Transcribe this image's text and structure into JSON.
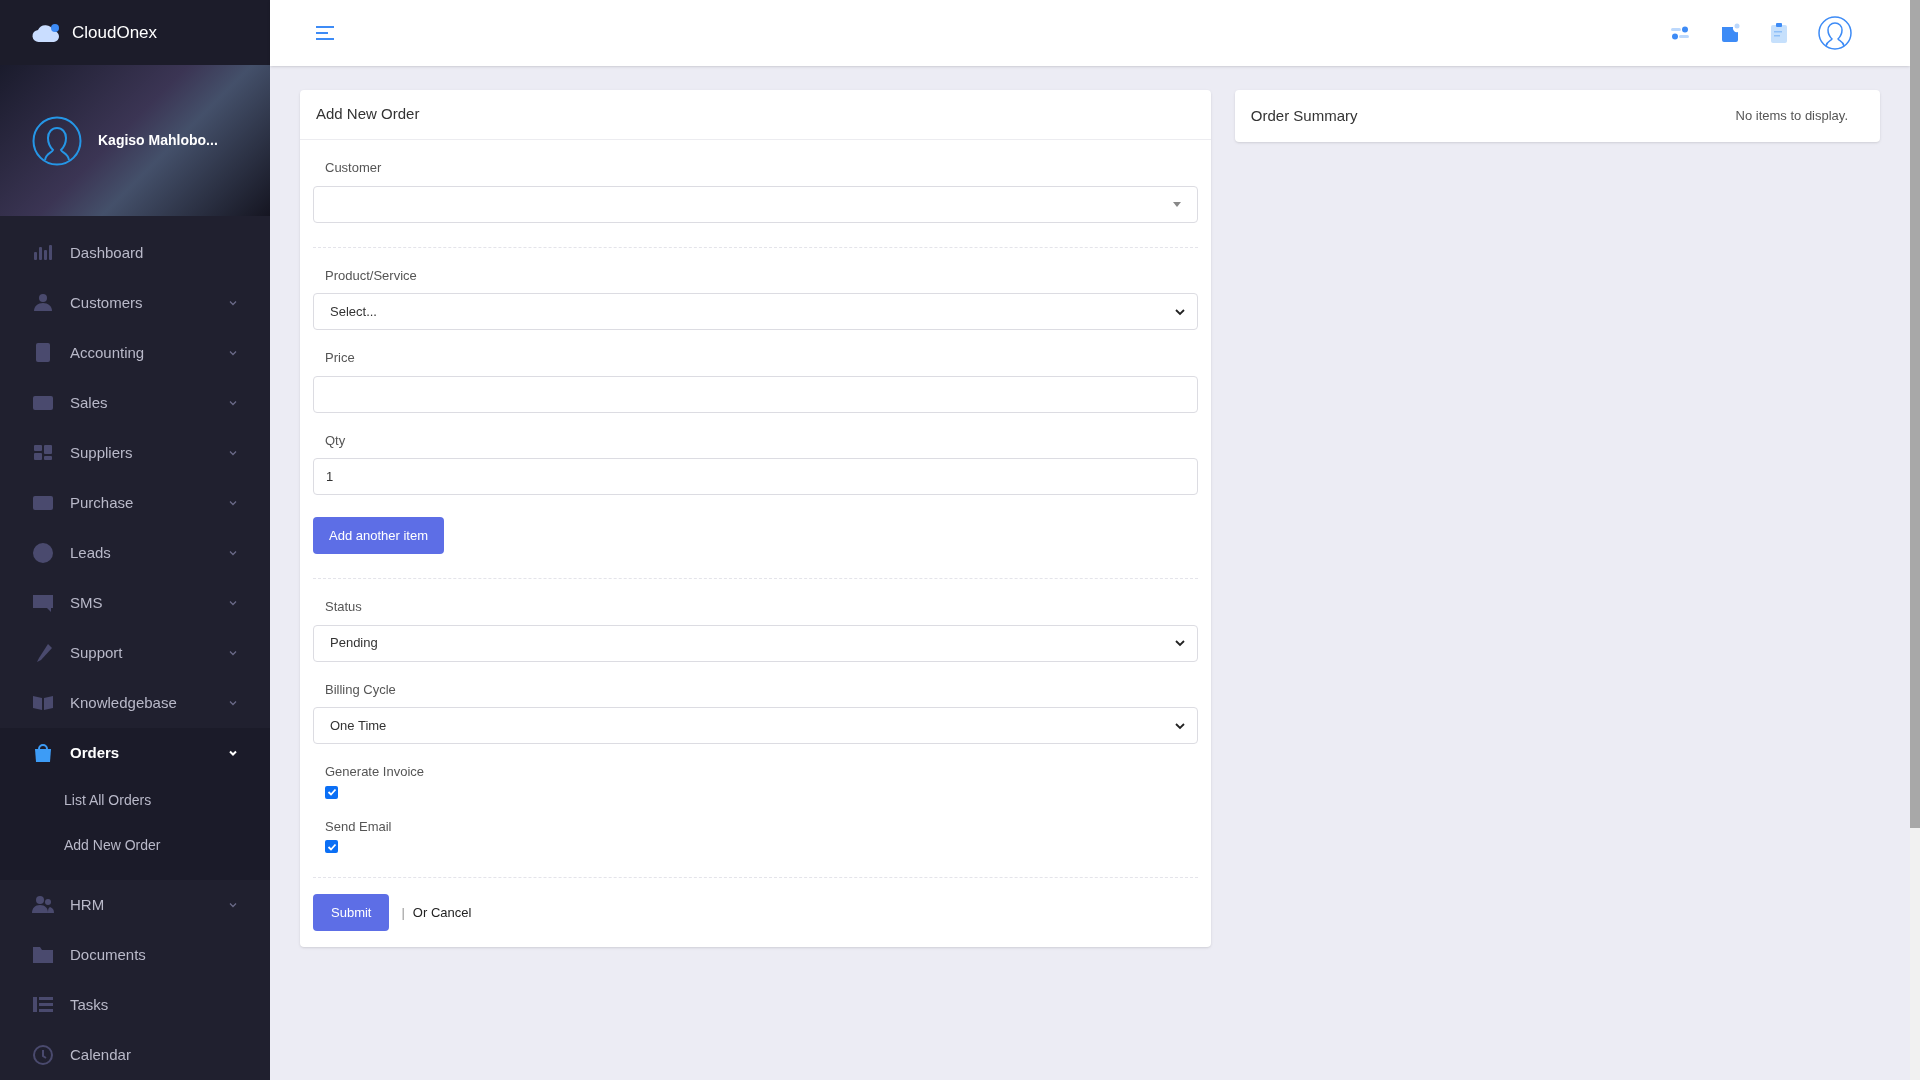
{
  "brand": {
    "name": "CloudOnex"
  },
  "profile": {
    "name": "Kagiso Mahlobo..."
  },
  "sidebar": {
    "items": [
      {
        "label": "Dashboard",
        "kind": "link",
        "selected": false
      },
      {
        "label": "Customers",
        "kind": "group",
        "selected": false,
        "expanded": false
      },
      {
        "label": "Accounting",
        "kind": "group",
        "selected": false,
        "expanded": false
      },
      {
        "label": "Sales",
        "kind": "group",
        "selected": false,
        "expanded": false
      },
      {
        "label": "Suppliers",
        "kind": "group",
        "selected": false,
        "expanded": false
      },
      {
        "label": "Purchase",
        "kind": "group",
        "selected": false,
        "expanded": false
      },
      {
        "label": "Leads",
        "kind": "group",
        "selected": false,
        "expanded": false
      },
      {
        "label": "SMS",
        "kind": "group",
        "selected": false,
        "expanded": false
      },
      {
        "label": "Support",
        "kind": "group",
        "selected": false,
        "expanded": false
      },
      {
        "label": "Knowledgebase",
        "kind": "group",
        "selected": false,
        "expanded": false
      },
      {
        "label": "Orders",
        "kind": "group",
        "selected": true,
        "expanded": true,
        "children": [
          {
            "label": "List All Orders"
          },
          {
            "label": "Add New Order"
          }
        ]
      },
      {
        "label": "HRM",
        "kind": "group",
        "selected": false,
        "expanded": false
      },
      {
        "label": "Documents",
        "kind": "link",
        "selected": false
      },
      {
        "label": "Tasks",
        "kind": "link",
        "selected": false
      },
      {
        "label": "Calendar",
        "kind": "link",
        "selected": false
      }
    ]
  },
  "form": {
    "title": "Add New Order",
    "groups": [
      [
        {
          "kind": "combo",
          "label": "Customer"
        }
      ],
      [
        {
          "kind": "select",
          "label": "Product/Service",
          "value": "Select..."
        },
        {
          "kind": "input",
          "label": "Price"
        },
        {
          "kind": "input",
          "label": "Qty",
          "value": "1"
        },
        {
          "kind": "button",
          "label": "Add another item"
        }
      ],
      [
        {
          "kind": "select",
          "label": "Status",
          "value": "Pending"
        },
        {
          "kind": "select",
          "label": "Billing Cycle",
          "value": "One Time"
        },
        {
          "kind": "checkbox",
          "label": "Generate Invoice",
          "checked": true
        },
        {
          "kind": "checkbox",
          "label": "Send Email",
          "checked": true
        }
      ]
    ],
    "submit": "Submit",
    "separator": "|",
    "cancel": "Or Cancel"
  },
  "summary": {
    "title": "Order Summary",
    "empty_text": "No items to display."
  }
}
